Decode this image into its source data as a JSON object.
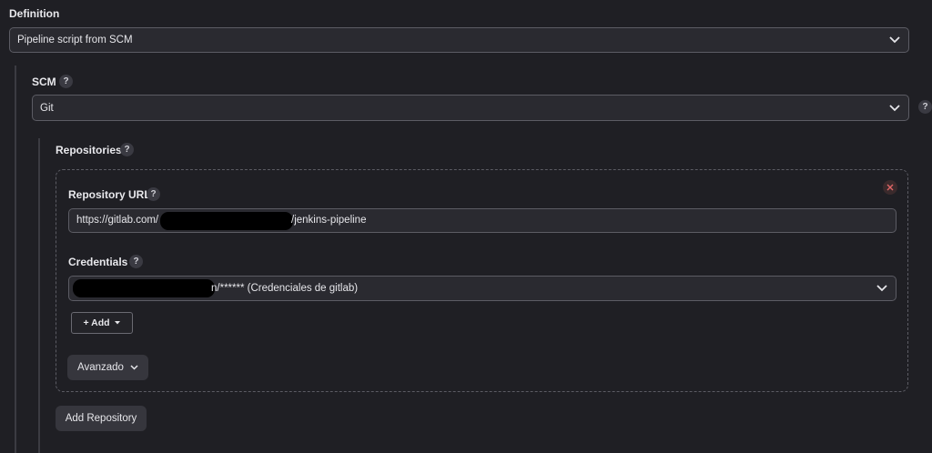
{
  "definition": {
    "label": "Definition",
    "selected": "Pipeline script from SCM"
  },
  "scm": {
    "label": "SCM",
    "selected": "Git",
    "help": "?"
  },
  "repositories": {
    "label": "Repositories",
    "help": "?",
    "repository_url": {
      "label": "Repository URL",
      "help": "?",
      "value_prefix": "https://gitlab.com/",
      "value_suffix": "/jenkins-pipeline"
    },
    "credentials": {
      "label": "Credentials",
      "help": "?",
      "selected_suffix": "n/****** (Credenciales de gitlab)"
    },
    "add_button": "+ Add",
    "advanced_button": "Avanzado",
    "add_repository_button": "Add Repository"
  },
  "colors": {
    "background": "#1f1f24",
    "input_bg": "#2a2a30",
    "border": "#5c5c64",
    "delete_icon": "#e06666"
  },
  "icons": [
    "chevron-down-icon",
    "help-icon",
    "close-icon",
    "caret-down-icon"
  ]
}
